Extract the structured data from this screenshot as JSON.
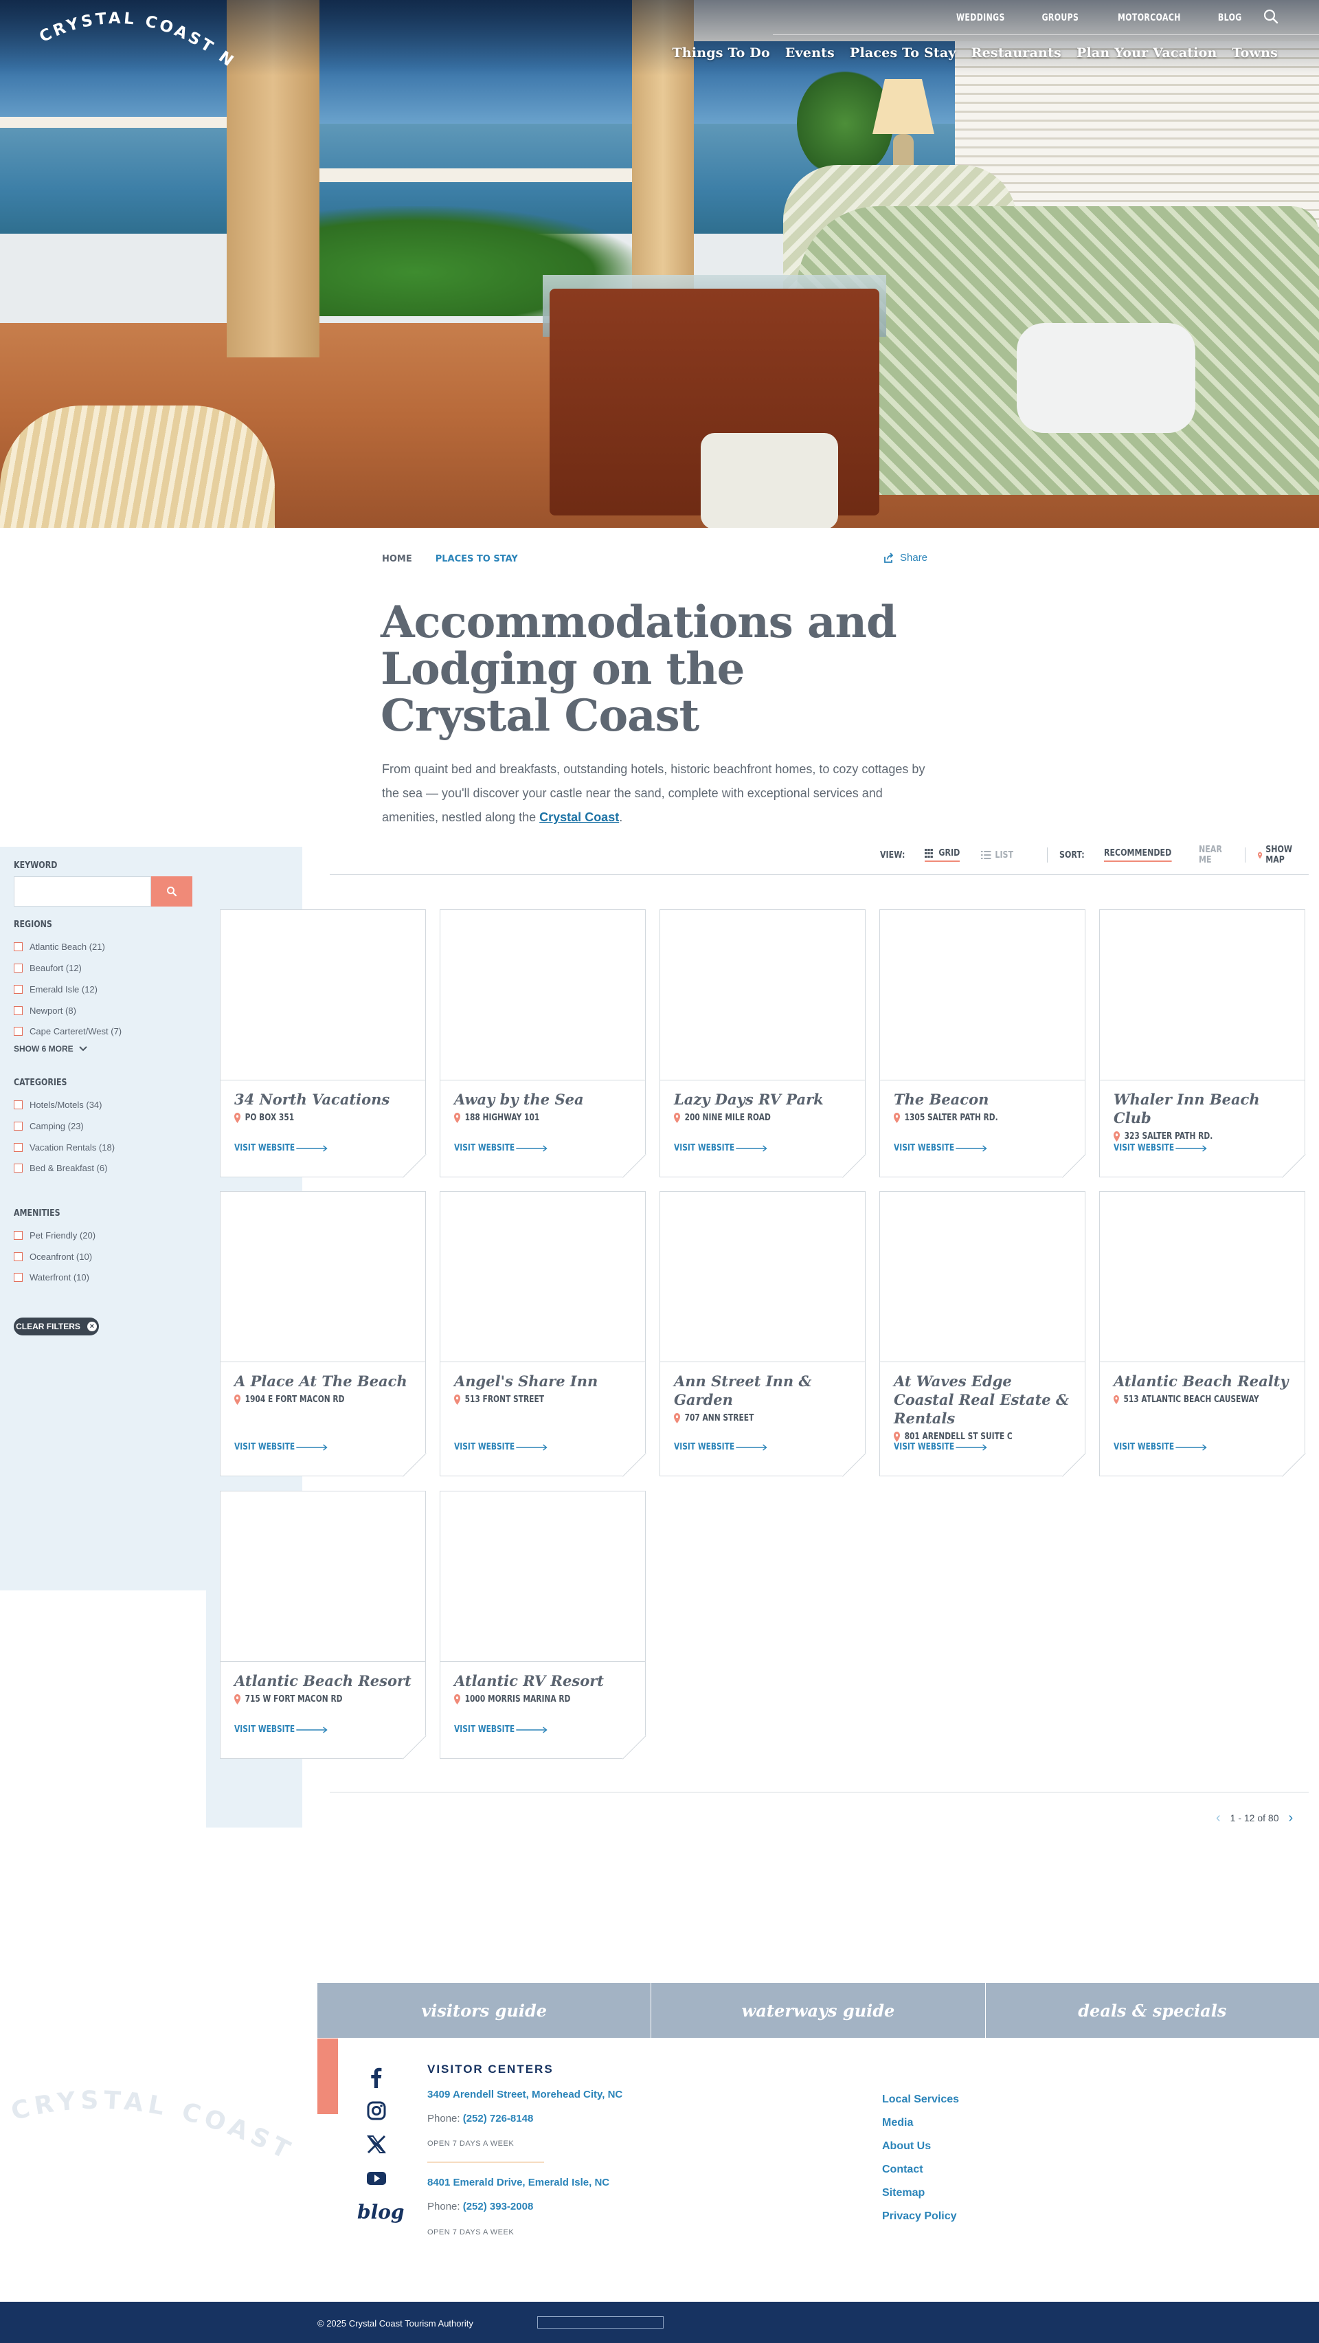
{
  "brand": {
    "logo_text": "CRYSTAL COAST N.C."
  },
  "utility_nav": [
    "WEDDINGS",
    "GROUPS",
    "MOTORCOACH",
    "BLOG"
  ],
  "main_nav": [
    "Things To Do",
    "Events",
    "Places To Stay",
    "Restaurants",
    "Plan Your Vacation",
    "Towns"
  ],
  "breadcrumb": {
    "home": "HOME",
    "current": "PLACES TO STAY"
  },
  "share_label": "Share",
  "page_title": "Accommodations and Lodging on the Crystal Coast",
  "intro": {
    "text": "From quaint bed and breakfasts, outstanding hotels, historic beachfront homes, to cozy cottages by the sea — you'll discover your castle near the sand, complete with exceptional services and amenities, nestled along the ",
    "link": "Crystal Coast",
    "end": "."
  },
  "filters": {
    "keyword_label": "KEYWORD",
    "keyword_value": "",
    "regions_label": "REGIONS",
    "regions": [
      "Atlantic Beach (21)",
      "Beaufort (12)",
      "Emerald Isle (12)",
      "Newport (8)",
      "Cape Carteret/West (7)"
    ],
    "show_more": "SHOW 6 MORE",
    "categories_label": "CATEGORIES",
    "categories": [
      "Hotels/Motels (34)",
      "Camping (23)",
      "Vacation Rentals (18)",
      "Bed & Breakfast (6)"
    ],
    "amenities_label": "AMENITIES",
    "amenities": [
      "Pet Friendly (20)",
      "Oceanfront (10)",
      "Waterfront (10)"
    ],
    "clear_filters": "CLEAR FILTERS"
  },
  "toolbar": {
    "view_label": "VIEW:",
    "grid": "GRID",
    "list": "LIST",
    "sort_label": "SORT:",
    "recommended": "RECOMMENDED",
    "near_me": "NEAR ME",
    "show_map": "SHOW MAP"
  },
  "listings": [
    {
      "name": "34 North Vacations",
      "address": "PO BOX 351"
    },
    {
      "name": "Away by the Sea",
      "address": "188 HIGHWAY 101"
    },
    {
      "name": "Lazy Days RV Park",
      "address": "200 NINE MILE ROAD"
    },
    {
      "name": "The Beacon",
      "address": "1305 SALTER PATH RD."
    },
    {
      "name": "Whaler Inn Beach Club",
      "address": "323 SALTER PATH RD."
    },
    {
      "name": "A Place At The Beach",
      "address": "1904 E FORT MACON RD"
    },
    {
      "name": "Angel's Share Inn",
      "address": "513 FRONT STREET"
    },
    {
      "name": "Ann Street Inn & Garden",
      "address": "707 ANN STREET"
    },
    {
      "name": "At Waves Edge Coastal Real Estate & Rentals",
      "address": "801 ARENDELL ST SUITE C"
    },
    {
      "name": "Atlantic Beach Realty",
      "address": "513 ATLANTIC BEACH CAUSEWAY"
    },
    {
      "name": "Atlantic Beach Resort",
      "address": "715 W FORT MACON RD"
    },
    {
      "name": "Atlantic RV Resort",
      "address": "1000 MORRIS MARINA RD"
    }
  ],
  "visit_label": "VISIT WEBSITE",
  "pagination": {
    "range": "1 - 12 of 80"
  },
  "footer": {
    "tabs": [
      "visitors guide",
      "waterways guide",
      "deals & specials"
    ],
    "blog": "blog",
    "visitor_centers_title": "VISITOR CENTERS",
    "centers": [
      {
        "address": "3409 Arendell Street, Morehead City, NC",
        "phone_label": "Phone: ",
        "phone": "(252) 726-8148",
        "hours": "OPEN 7 DAYS A WEEK"
      },
      {
        "address": "8401 Emerald Drive, Emerald Isle, NC",
        "phone_label": "Phone: ",
        "phone": "(252) 393-2008",
        "hours": "OPEN 7 DAYS A WEEK"
      }
    ],
    "links": [
      "Local Services",
      "Media",
      "About Us",
      "Contact",
      "Sitemap",
      "Privacy Policy"
    ],
    "copyright": "© 2025 Crystal Coast Tourism Authority"
  },
  "colors": {
    "accent": "#f08a78",
    "link": "#2b84b9",
    "navy": "#173361",
    "sidebar": "#e8f1f7",
    "tabs": "#a3b3c4"
  }
}
